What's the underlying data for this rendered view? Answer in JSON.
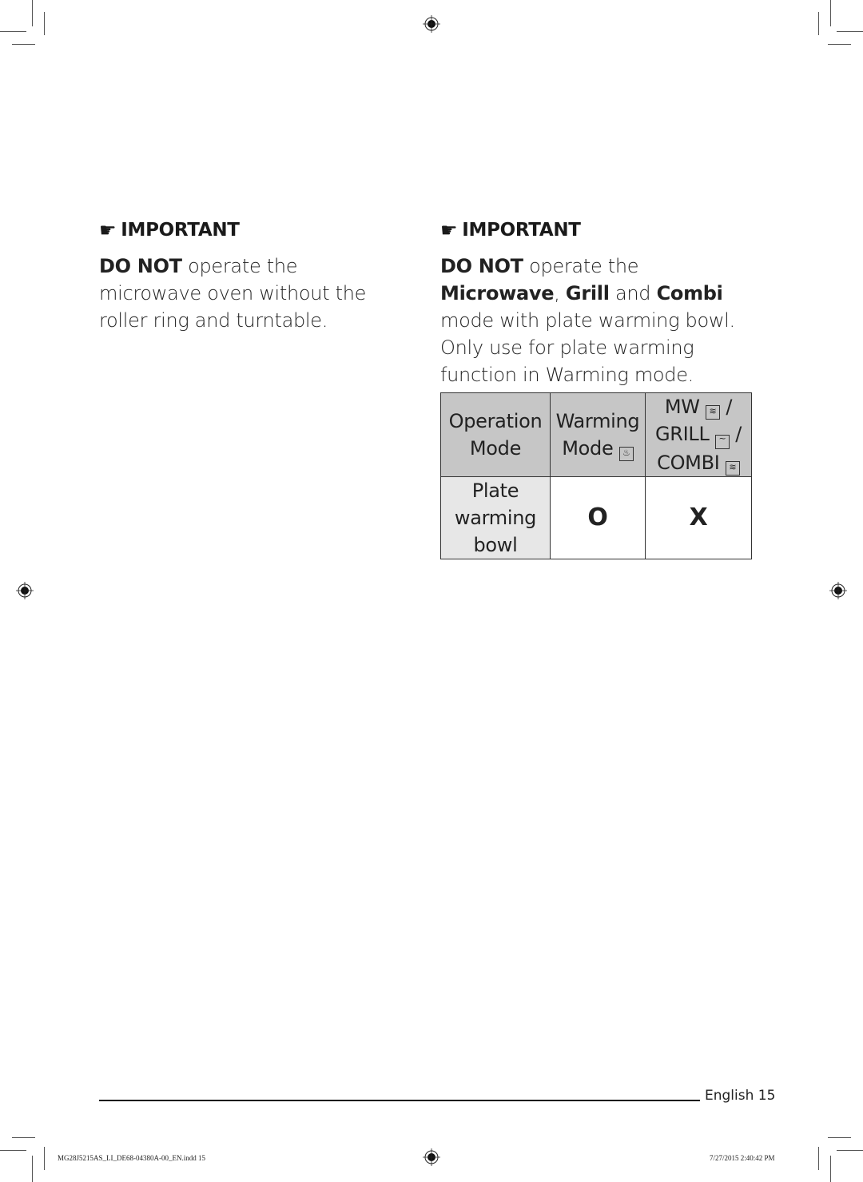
{
  "left_note": {
    "icon": "pointing-hand-icon",
    "heading": "IMPORTANT",
    "emphasis": "DO NOT",
    "text": " operate the microwave oven without the roller ring and turntable."
  },
  "right_note": {
    "icon": "pointing-hand-icon",
    "heading": "IMPORTANT",
    "parts": {
      "p1": "DO NOT",
      "p2": " operate the ",
      "p3": "Microwave",
      "p4": ", ",
      "p5": "Grill",
      "p6": " and ",
      "p7": "Combi",
      "p8": " mode with plate warming bowl. Only use for plate warming function in Warming mode."
    }
  },
  "table": {
    "headers": {
      "operation_mode": "Operation Mode",
      "warming_mode": "Warming Mode",
      "mw": "MW",
      "grill": "GRILL",
      "combi": "COMBI",
      "separator": "/"
    },
    "icons": {
      "warming": "warming-mode-icon",
      "mw": "microwave-icon",
      "grill": "grill-icon",
      "combi": "combi-icon"
    },
    "rows": [
      {
        "label": "Plate warming bowl",
        "warming": "O",
        "other": "X"
      }
    ]
  },
  "footer": {
    "language": "English",
    "page": "15",
    "file": "MG28J5215AS_LI_DE68-04380A-00_EN.indd   15",
    "timestamp": "7/27/2015   2:40:42 PM"
  }
}
